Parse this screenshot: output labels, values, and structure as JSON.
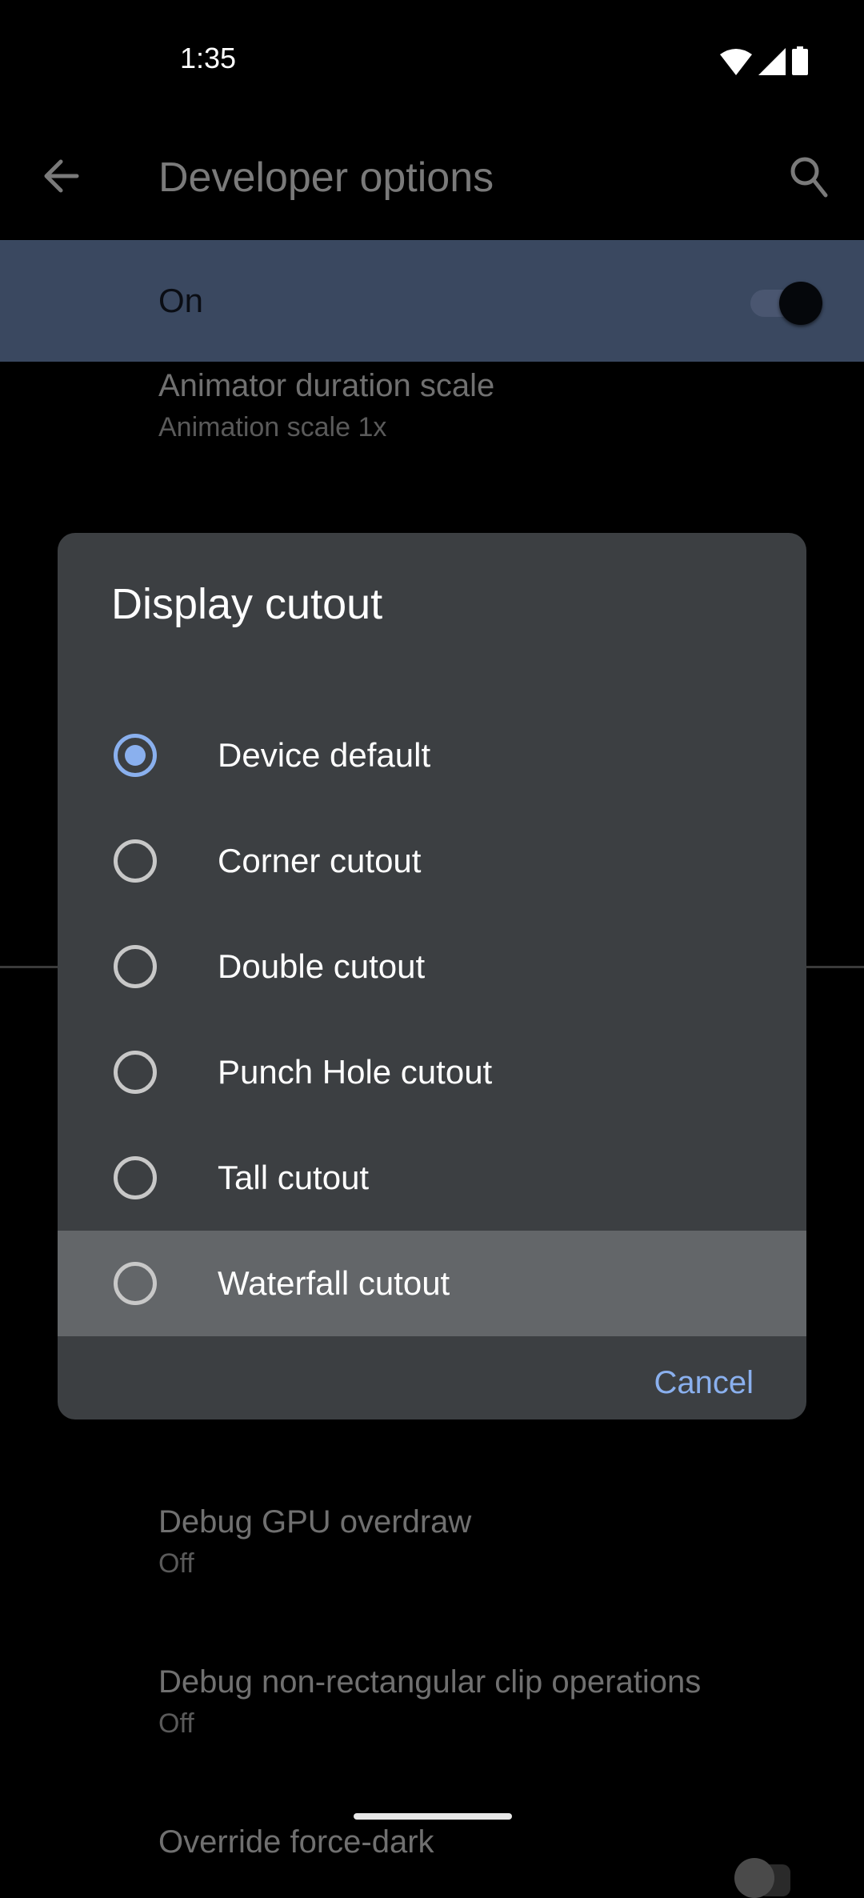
{
  "status_bar": {
    "time": "1:35",
    "icons": [
      "wifi-icon",
      "cellular-signal-icon",
      "battery-icon"
    ]
  },
  "app_bar": {
    "title": "Developer options",
    "back_icon": "arrow-back-icon",
    "search_icon": "search-icon"
  },
  "master_switch": {
    "label": "On",
    "state": true,
    "background": "#3a4860"
  },
  "background_prefs": [
    {
      "title": "Animator duration scale",
      "summary": "Animation scale 1x"
    },
    {
      "title": "Debug GPU overdraw",
      "summary": "Off"
    },
    {
      "title": "Debug non-rectangular clip operations",
      "summary": "Off"
    },
    {
      "title": "Override force-dark",
      "summary": ""
    }
  ],
  "dialog": {
    "title": "Display cutout",
    "options": [
      {
        "label": "Device default",
        "selected": true
      },
      {
        "label": "Corner cutout",
        "selected": false
      },
      {
        "label": "Double cutout",
        "selected": false
      },
      {
        "label": "Punch Hole cutout",
        "selected": false
      },
      {
        "label": "Tall cutout",
        "selected": false
      },
      {
        "label": "Waterfall cutout",
        "selected": false,
        "highlighted": true
      }
    ],
    "cancel_label": "Cancel",
    "accent_color": "#8ab0ee"
  }
}
